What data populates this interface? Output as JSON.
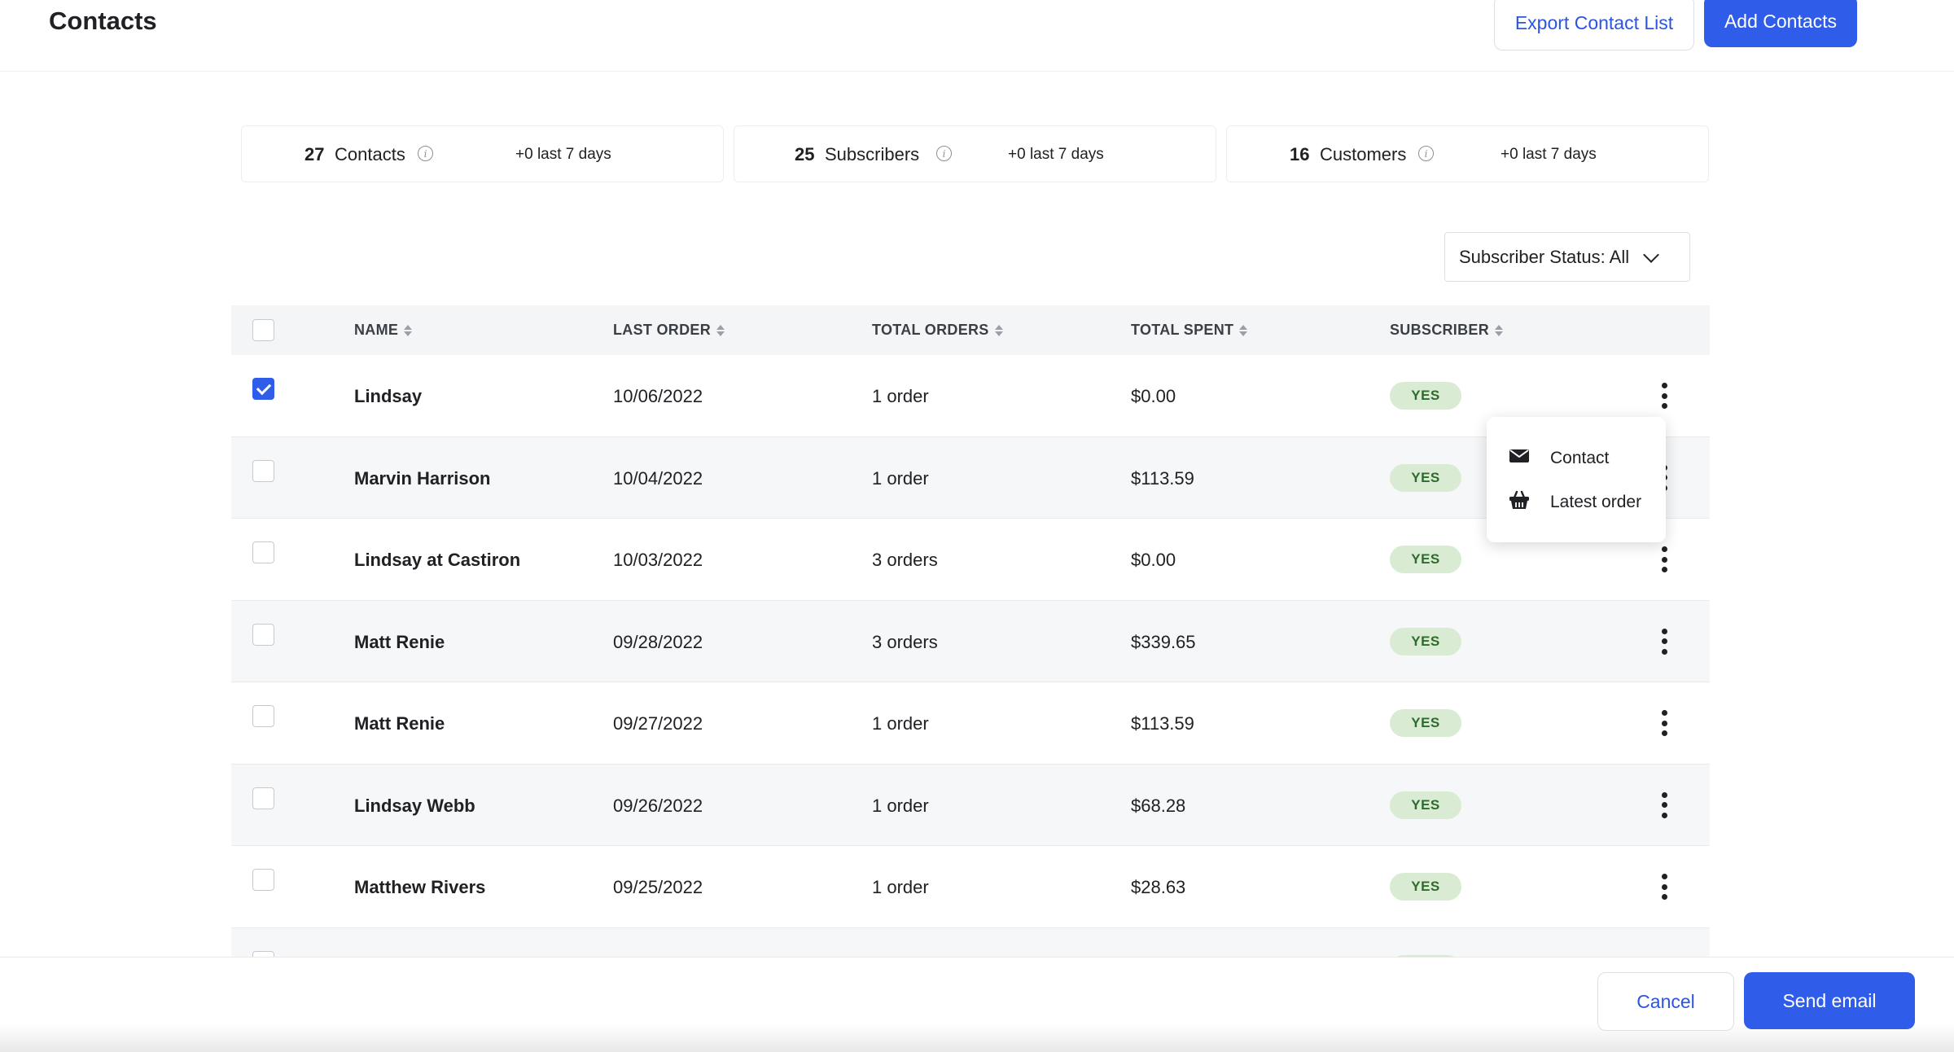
{
  "header": {
    "title": "Contacts",
    "export_label": "Export Contact List",
    "add_label": "Add Contacts"
  },
  "stats": [
    {
      "count": "27",
      "label": "Contacts",
      "delta": "+0 last 7 days"
    },
    {
      "count": "25",
      "label": "Subscribers",
      "delta": "+0 last 7 days"
    },
    {
      "count": "16",
      "label": "Customers",
      "delta": "+0 last 7 days"
    }
  ],
  "filter": {
    "label": "Subscriber Status: All"
  },
  "table": {
    "columns": [
      "NAME",
      "LAST ORDER",
      "TOTAL ORDERS",
      "TOTAL SPENT",
      "SUBSCRIBER"
    ],
    "rows": [
      {
        "name": "Lindsay",
        "last_order": "10/06/2022",
        "total_orders": "1 order",
        "total_spent": "$0.00",
        "subscriber": "YES",
        "checked": true
      },
      {
        "name": "Marvin Harrison",
        "last_order": "10/04/2022",
        "total_orders": "1 order",
        "total_spent": "$113.59",
        "subscriber": "YES",
        "checked": false
      },
      {
        "name": "Lindsay at Castiron",
        "last_order": "10/03/2022",
        "total_orders": "3 orders",
        "total_spent": "$0.00",
        "subscriber": "YES",
        "checked": false
      },
      {
        "name": "Matt Renie",
        "last_order": "09/28/2022",
        "total_orders": "3 orders",
        "total_spent": "$339.65",
        "subscriber": "YES",
        "checked": false
      },
      {
        "name": "Matt Renie",
        "last_order": "09/27/2022",
        "total_orders": "1 order",
        "total_spent": "$113.59",
        "subscriber": "YES",
        "checked": false
      },
      {
        "name": "Lindsay Webb",
        "last_order": "09/26/2022",
        "total_orders": "1 order",
        "total_spent": "$68.28",
        "subscriber": "YES",
        "checked": false
      },
      {
        "name": "Matthew Rivers",
        "last_order": "09/25/2022",
        "total_orders": "1 order",
        "total_spent": "$28.63",
        "subscriber": "YES",
        "checked": false
      }
    ]
  },
  "row_menu": {
    "items": [
      {
        "label": "Contact",
        "icon": "envelope-icon"
      },
      {
        "label": "Latest order",
        "icon": "basket-icon"
      }
    ]
  },
  "footer": {
    "cancel_label": "Cancel",
    "send_label": "Send email"
  },
  "colors": {
    "primary": "#2f5ce8",
    "link": "#2b55e0",
    "badge_bg": "#d9ecd3",
    "badge_text": "#2e6b2d"
  }
}
